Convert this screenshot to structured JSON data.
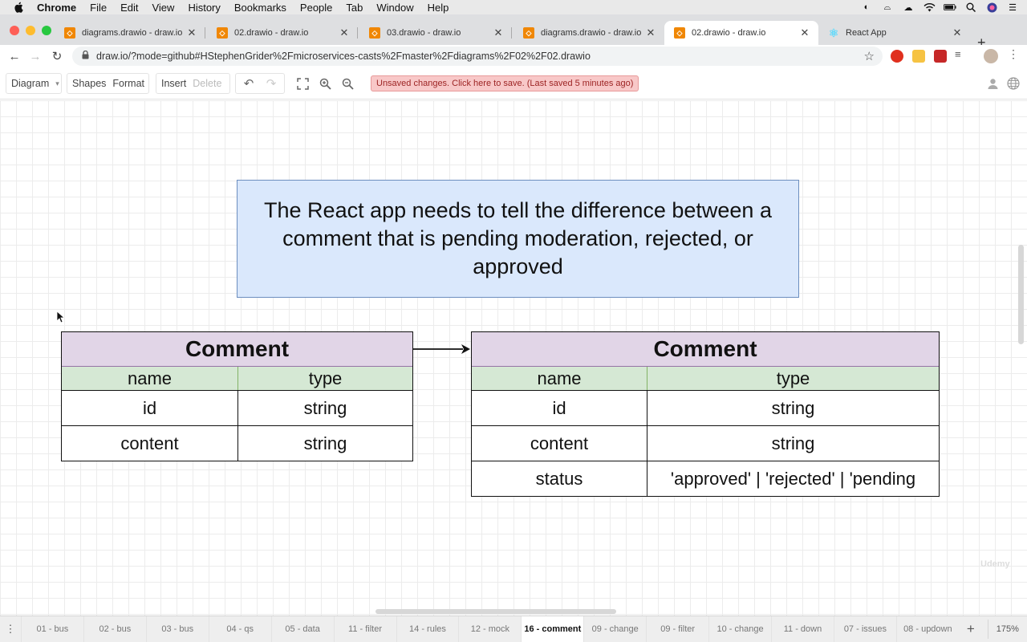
{
  "menubar": {
    "items": [
      "Chrome",
      "File",
      "Edit",
      "View",
      "History",
      "Bookmarks",
      "People",
      "Tab",
      "Window",
      "Help"
    ]
  },
  "tabs": [
    {
      "title": "diagrams.drawio - draw.io",
      "icon": "drawio-icon"
    },
    {
      "title": "02.drawio - draw.io",
      "icon": "drawio-icon"
    },
    {
      "title": "03.drawio - draw.io",
      "icon": "drawio-icon"
    },
    {
      "title": "diagrams.drawio - draw.io",
      "icon": "drawio-icon"
    },
    {
      "title": "02.drawio - draw.io",
      "icon": "drawio-icon",
      "active": true
    },
    {
      "title": "React App",
      "icon": "react-icon"
    }
  ],
  "omnibox": {
    "url": "draw.io/?mode=github#HStephenGrider%2Fmicroservices-casts%2Fmaster%2Fdiagrams%2F02%2F02.drawio"
  },
  "toolbar": {
    "diagram_label": "Diagram",
    "shapes_label": "Shapes",
    "format_label": "Format",
    "insert_label": "Insert",
    "delete_label": "Delete",
    "unsaved_msg": "Unsaved changes. Click here to save. (Last saved 5 minutes ago)"
  },
  "canvas": {
    "note": "The React app needs to tell the difference between a comment that is pending moderation, rejected, or approved",
    "left_table": {
      "title": "Comment",
      "headers": [
        "name",
        "type"
      ],
      "rows": [
        [
          "id",
          "string"
        ],
        [
          "content",
          "string"
        ]
      ]
    },
    "right_table": {
      "title": "Comment",
      "headers": [
        "name",
        "type"
      ],
      "rows": [
        [
          "id",
          "string"
        ],
        [
          "content",
          "string"
        ],
        [
          "status",
          "'approved' | 'rejected' | 'pending"
        ]
      ]
    },
    "watermark": "Udemy"
  },
  "pages": [
    "01 - bus",
    "02 - bus",
    "03 - bus",
    "04 - qs",
    "05 - data",
    "11 - filter",
    "14 - rules",
    "12 - mock",
    "16 - comment",
    "09 - change",
    "09 - filter",
    "10 - change",
    "11 - down",
    "07 - issues",
    "08 - updown"
  ],
  "active_page": "16 - comment",
  "zoom": "175%",
  "colors": {
    "note_fill": "#dae8fc",
    "note_stroke": "#6c8ebf",
    "table_head_fill": "#e1d5e7",
    "table_header_row_fill": "#d5e8d4",
    "unsaved_fill": "#f8c8c8"
  }
}
